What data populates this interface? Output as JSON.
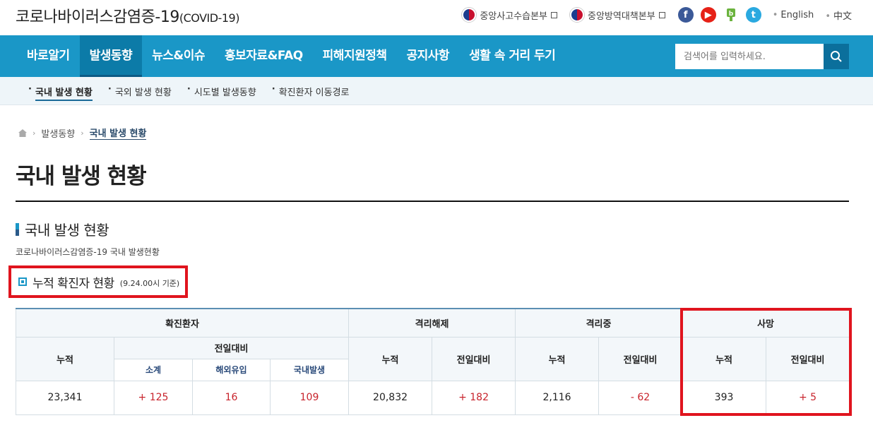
{
  "header": {
    "site_title": "코로나바이러스감염증-19",
    "site_title_sub": "(COVID-19)",
    "gov_links": [
      "중앙사고수습본부",
      "중앙방역대책본부"
    ],
    "social": [
      "f",
      "▶",
      "b",
      "t"
    ],
    "langs": [
      "English",
      "中文"
    ]
  },
  "nav": {
    "items": [
      "바로알기",
      "발생동향",
      "뉴스&이슈",
      "홍보자료&FAQ",
      "피해지원정책",
      "공지사항",
      "생활 속 거리 두기"
    ],
    "active_index": 1,
    "search_placeholder": "검색어를 입력하세요."
  },
  "subnav": {
    "items": [
      "국내 발생 현황",
      "국외 발생 현황",
      "시도별 발생동향",
      "확진환자 이동경로"
    ]
  },
  "breadcrumb": [
    "발생동향",
    "국내 발생 현황"
  ],
  "page_title": "국내 발생 현황",
  "section": {
    "title": "국내 발생 현황",
    "desc": "코로나바이러스감염증-19 국내 발생현황",
    "subsection_title": "누적 확진자 현황",
    "subsection_note": "(9.24.00시 기준)"
  },
  "table": {
    "groups": [
      "확진환자",
      "격리해제",
      "격리중",
      "사망"
    ],
    "col_cumulative": "누적",
    "col_daily": "전일대비",
    "sub_cols": [
      "소계",
      "해외유입",
      "국내발생"
    ],
    "confirmed": {
      "cumulative": "23,341",
      "daily_total": "+ 125",
      "overseas": "16",
      "domestic": "109"
    },
    "released": {
      "cumulative": "20,832",
      "daily": "+ 182"
    },
    "isolated": {
      "cumulative": "2,116",
      "daily": "- 62"
    },
    "deaths": {
      "cumulative": "393",
      "daily": "+ 5"
    }
  },
  "colors": {
    "nav": "#1a97c7",
    "highlight": "#e0141e",
    "red_text": "#c8232c"
  }
}
